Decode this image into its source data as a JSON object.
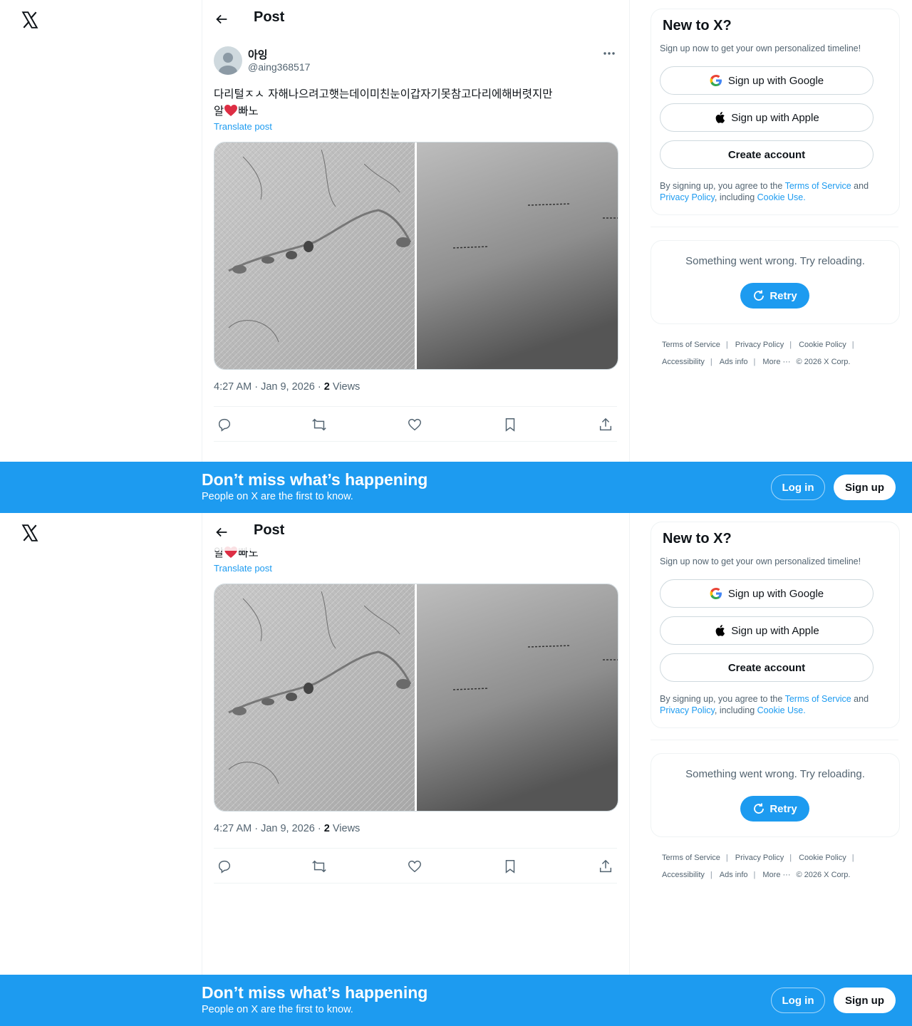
{
  "colors": {
    "accent": "#1d9bf0",
    "text": "#0f1419",
    "muted": "#536471",
    "border": "#eff3f4"
  },
  "header": {
    "title": "Post",
    "back_icon": "arrow-left-icon"
  },
  "post": {
    "display_name": "아잉",
    "handle": "@aing368517",
    "text_line1": "다리털ㅈㅅ 자해나으려고햇는데이미친눈이갑자기못참고다리에해버렷지만",
    "text_line2_pre": "알",
    "text_line2_post": "빠노",
    "translate": "Translate post",
    "time": "4:27 AM · Jan 9, 2026 · ",
    "views_count": "2",
    "views_label": " Views"
  },
  "sidebar": {
    "title": "New to X?",
    "subtitle": "Sign up now to get your own personalized timeline!",
    "google_btn": "Sign up with Google",
    "apple_btn": "Sign up with Apple",
    "create_btn": "Create account",
    "legal_1": "By signing up, you agree to the ",
    "legal_tos": "Terms of Service",
    "legal_2": " and ",
    "legal_pp": "Privacy Policy",
    "legal_3": ", including ",
    "legal_cookie": "Cookie Use.",
    "error_text": "Something went wrong. Try reloading.",
    "retry": "Retry"
  },
  "footer": {
    "tos": "Terms of Service",
    "privacy": "Privacy Policy",
    "cookie": "Cookie Policy",
    "accessibility": "Accessibility",
    "ads": "Ads info",
    "more": "More ···",
    "copyright": "© 2026 X Corp."
  },
  "banner": {
    "title": "Don’t miss what’s happening",
    "subtitle": "People on X are the first to know.",
    "login": "Log in",
    "signup": "Sign up"
  }
}
